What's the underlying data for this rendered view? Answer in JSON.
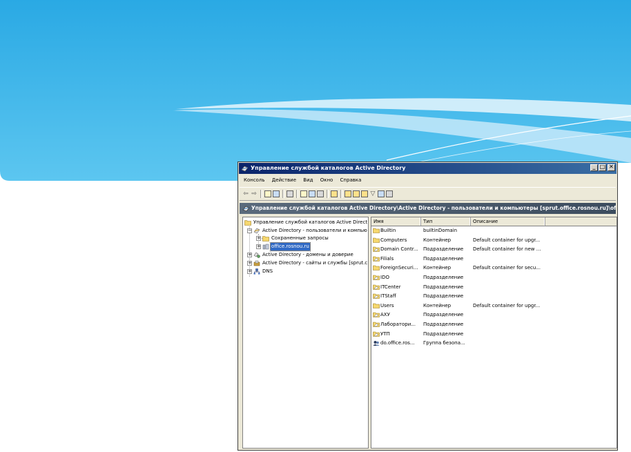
{
  "window": {
    "title": "Управление службой каталогов Active Directory",
    "controls": {
      "minimize": "_",
      "maximize": "□",
      "close": "✕"
    }
  },
  "menu": {
    "items": [
      "Консоль",
      "Действие",
      "Вид",
      "Окно",
      "Справка"
    ]
  },
  "path_bar": {
    "text": "Управление службой каталогов Active Directory\\Active Directory - пользователи и компьютеры [sprut.office.rosnou.ru]\\office"
  },
  "tree": {
    "root": "Управление службой каталогов Active Direct",
    "items": [
      {
        "label": "Active Directory - пользователи и компью",
        "expander": "−",
        "icon": "ad-users-computers-icon"
      },
      {
        "label": "Сохраненные запросы",
        "expander": "+",
        "icon": "folder-icon"
      },
      {
        "label": "office.rosnou.ru",
        "expander": "+",
        "icon": "domain-icon",
        "selected": true
      },
      {
        "label": "Active Directory - домены и доверие",
        "expander": "+",
        "icon": "domains-trusts-icon"
      },
      {
        "label": "Active Directory - сайты и службы [sprut.c",
        "expander": "+",
        "icon": "sites-services-icon"
      },
      {
        "label": "DNS",
        "expander": "+",
        "icon": "dns-icon"
      }
    ]
  },
  "list": {
    "columns": [
      "Имя",
      "Тип",
      "Описание"
    ],
    "rows": [
      {
        "name": "Builtin",
        "type": "builtinDomain",
        "description": "",
        "icon": "folder"
      },
      {
        "name": "Computers",
        "type": "Контейнер",
        "description": "Default container for upgr...",
        "icon": "folder"
      },
      {
        "name": "Domain Contr...",
        "type": "Подразделение",
        "description": "Default container for new ...",
        "icon": "ou"
      },
      {
        "name": "Filials",
        "type": "Подразделение",
        "description": "",
        "icon": "ou"
      },
      {
        "name": "ForeignSecuri...",
        "type": "Контейнер",
        "description": "Default container for secu...",
        "icon": "folder"
      },
      {
        "name": "IDO",
        "type": "Подразделение",
        "description": "",
        "icon": "ou"
      },
      {
        "name": "ITCenter",
        "type": "Подразделение",
        "description": "",
        "icon": "ou"
      },
      {
        "name": "ITStaff",
        "type": "Подразделение",
        "description": "",
        "icon": "ou"
      },
      {
        "name": "Users",
        "type": "Контейнер",
        "description": "Default container for upgr...",
        "icon": "folder"
      },
      {
        "name": "АХУ",
        "type": "Подразделение",
        "description": "",
        "icon": "ou"
      },
      {
        "name": "Лаборатори...",
        "type": "Подразделение",
        "description": "",
        "icon": "ou"
      },
      {
        "name": "УТП",
        "type": "Подразделение",
        "description": "",
        "icon": "ou"
      },
      {
        "name": "do.office.ros...",
        "type": "Группа безопа...",
        "description": "",
        "icon": "group"
      }
    ]
  },
  "colors": {
    "title_bar": "#0a246a",
    "path_bar": "#4a5a6c",
    "selection": "#316ac5",
    "folder": "#f5d76e",
    "slide_sky": "#3fb6ea"
  }
}
